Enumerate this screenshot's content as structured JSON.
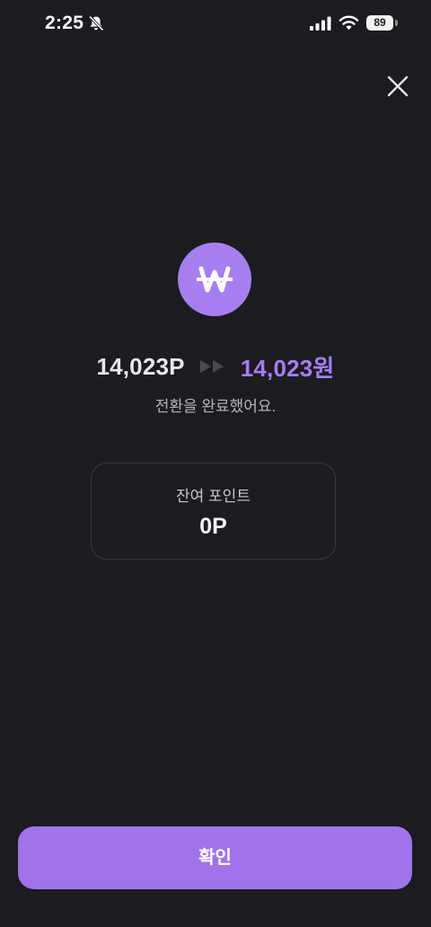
{
  "status_bar": {
    "time": "2:25",
    "battery_level": "89",
    "icons": [
      "bell-slash-icon",
      "signal-icon",
      "wifi-icon",
      "battery-icon"
    ]
  },
  "header": {
    "close_icon": "close-icon"
  },
  "conversion": {
    "coin_icon": "won-coin-icon",
    "from_amount": "14,023P",
    "arrow_icon": "double-chevron-right-icon",
    "to_amount": "14,023원",
    "message": "전환을 완료했어요."
  },
  "points_card": {
    "label": "잔여 포인트",
    "value": "0P"
  },
  "footer": {
    "confirm_label": "확인"
  },
  "colors": {
    "background": "#1c1b20",
    "accent": "#a173ea",
    "coin": "#a77ef0",
    "to_amount": "#a57ef2"
  }
}
